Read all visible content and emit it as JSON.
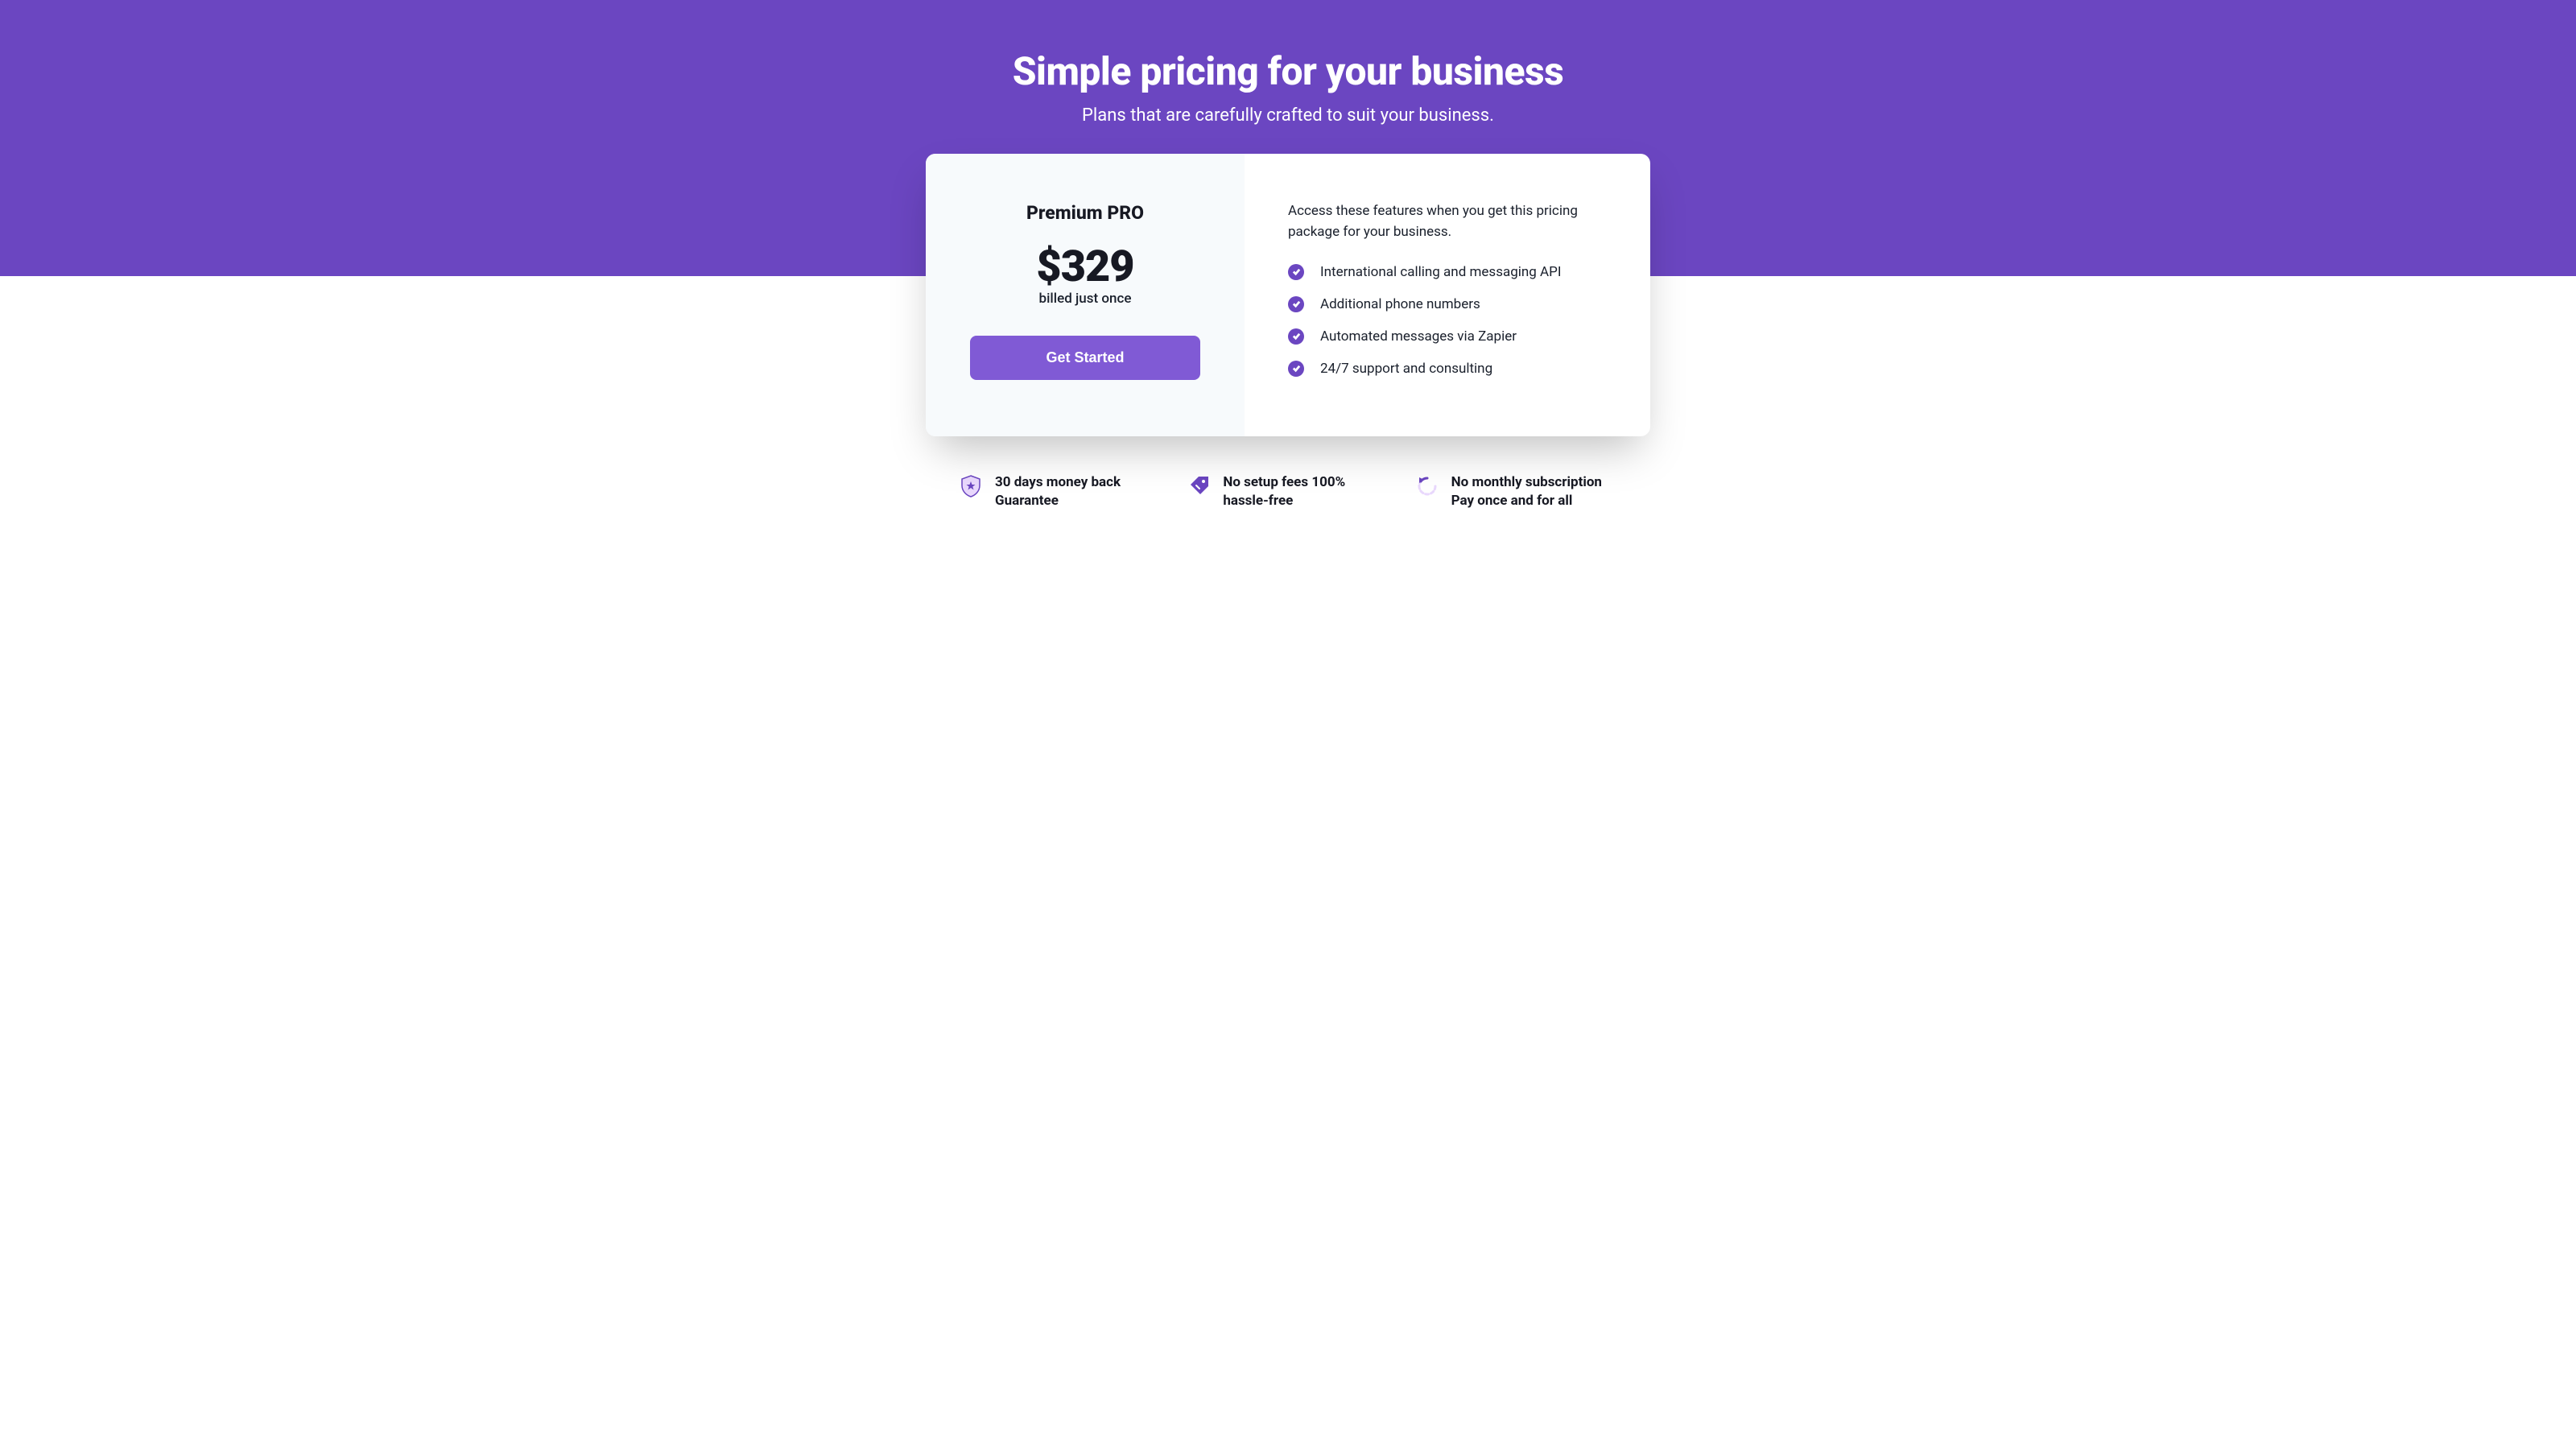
{
  "hero": {
    "title": "Simple pricing for your business",
    "subtitle": "Plans that are carefully crafted to suit your business."
  },
  "pricing": {
    "plan_name": "Premium PRO",
    "price": "$329",
    "billing_note": "billed just once",
    "cta_label": "Get Started",
    "features_lead": "Access these features when you get this pricing package for your business.",
    "features": [
      "International calling and messaging API",
      "Additional phone numbers",
      "Automated messages via Zapier",
      "24/7 support and consulting"
    ]
  },
  "benefits": [
    {
      "icon": "shield-star",
      "text": "30 days money back Guarantee"
    },
    {
      "icon": "tag",
      "text": "No setup fees 100% hassle-free"
    },
    {
      "icon": "refresh",
      "text": "No monthly subscription Pay once and for all"
    }
  ],
  "colors": {
    "primary": "#6B46C1",
    "primary_light": "#805AD5"
  }
}
